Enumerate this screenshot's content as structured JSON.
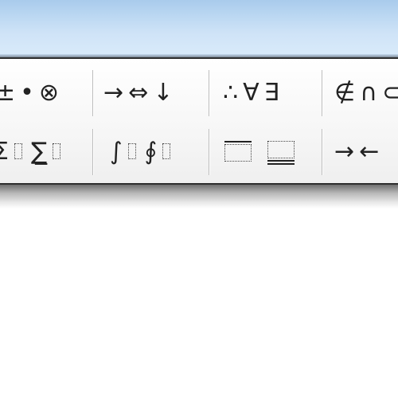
{
  "toolbar": {
    "row1": {
      "group1": [
        "±",
        "•",
        "⊗"
      ],
      "group2": [
        "→",
        "⇔",
        "↓"
      ],
      "group3": [
        "∴",
        "∀",
        "∃"
      ],
      "group4": [
        "∉",
        "∩",
        "⊂"
      ]
    },
    "row2": {
      "group1": [
        "Σ",
        "∑̲"
      ],
      "group2": [
        "∫",
        "∮"
      ],
      "group3": [
        "overbar-template",
        "underbar-template"
      ],
      "group4": [
        "→",
        "←"
      ]
    }
  }
}
